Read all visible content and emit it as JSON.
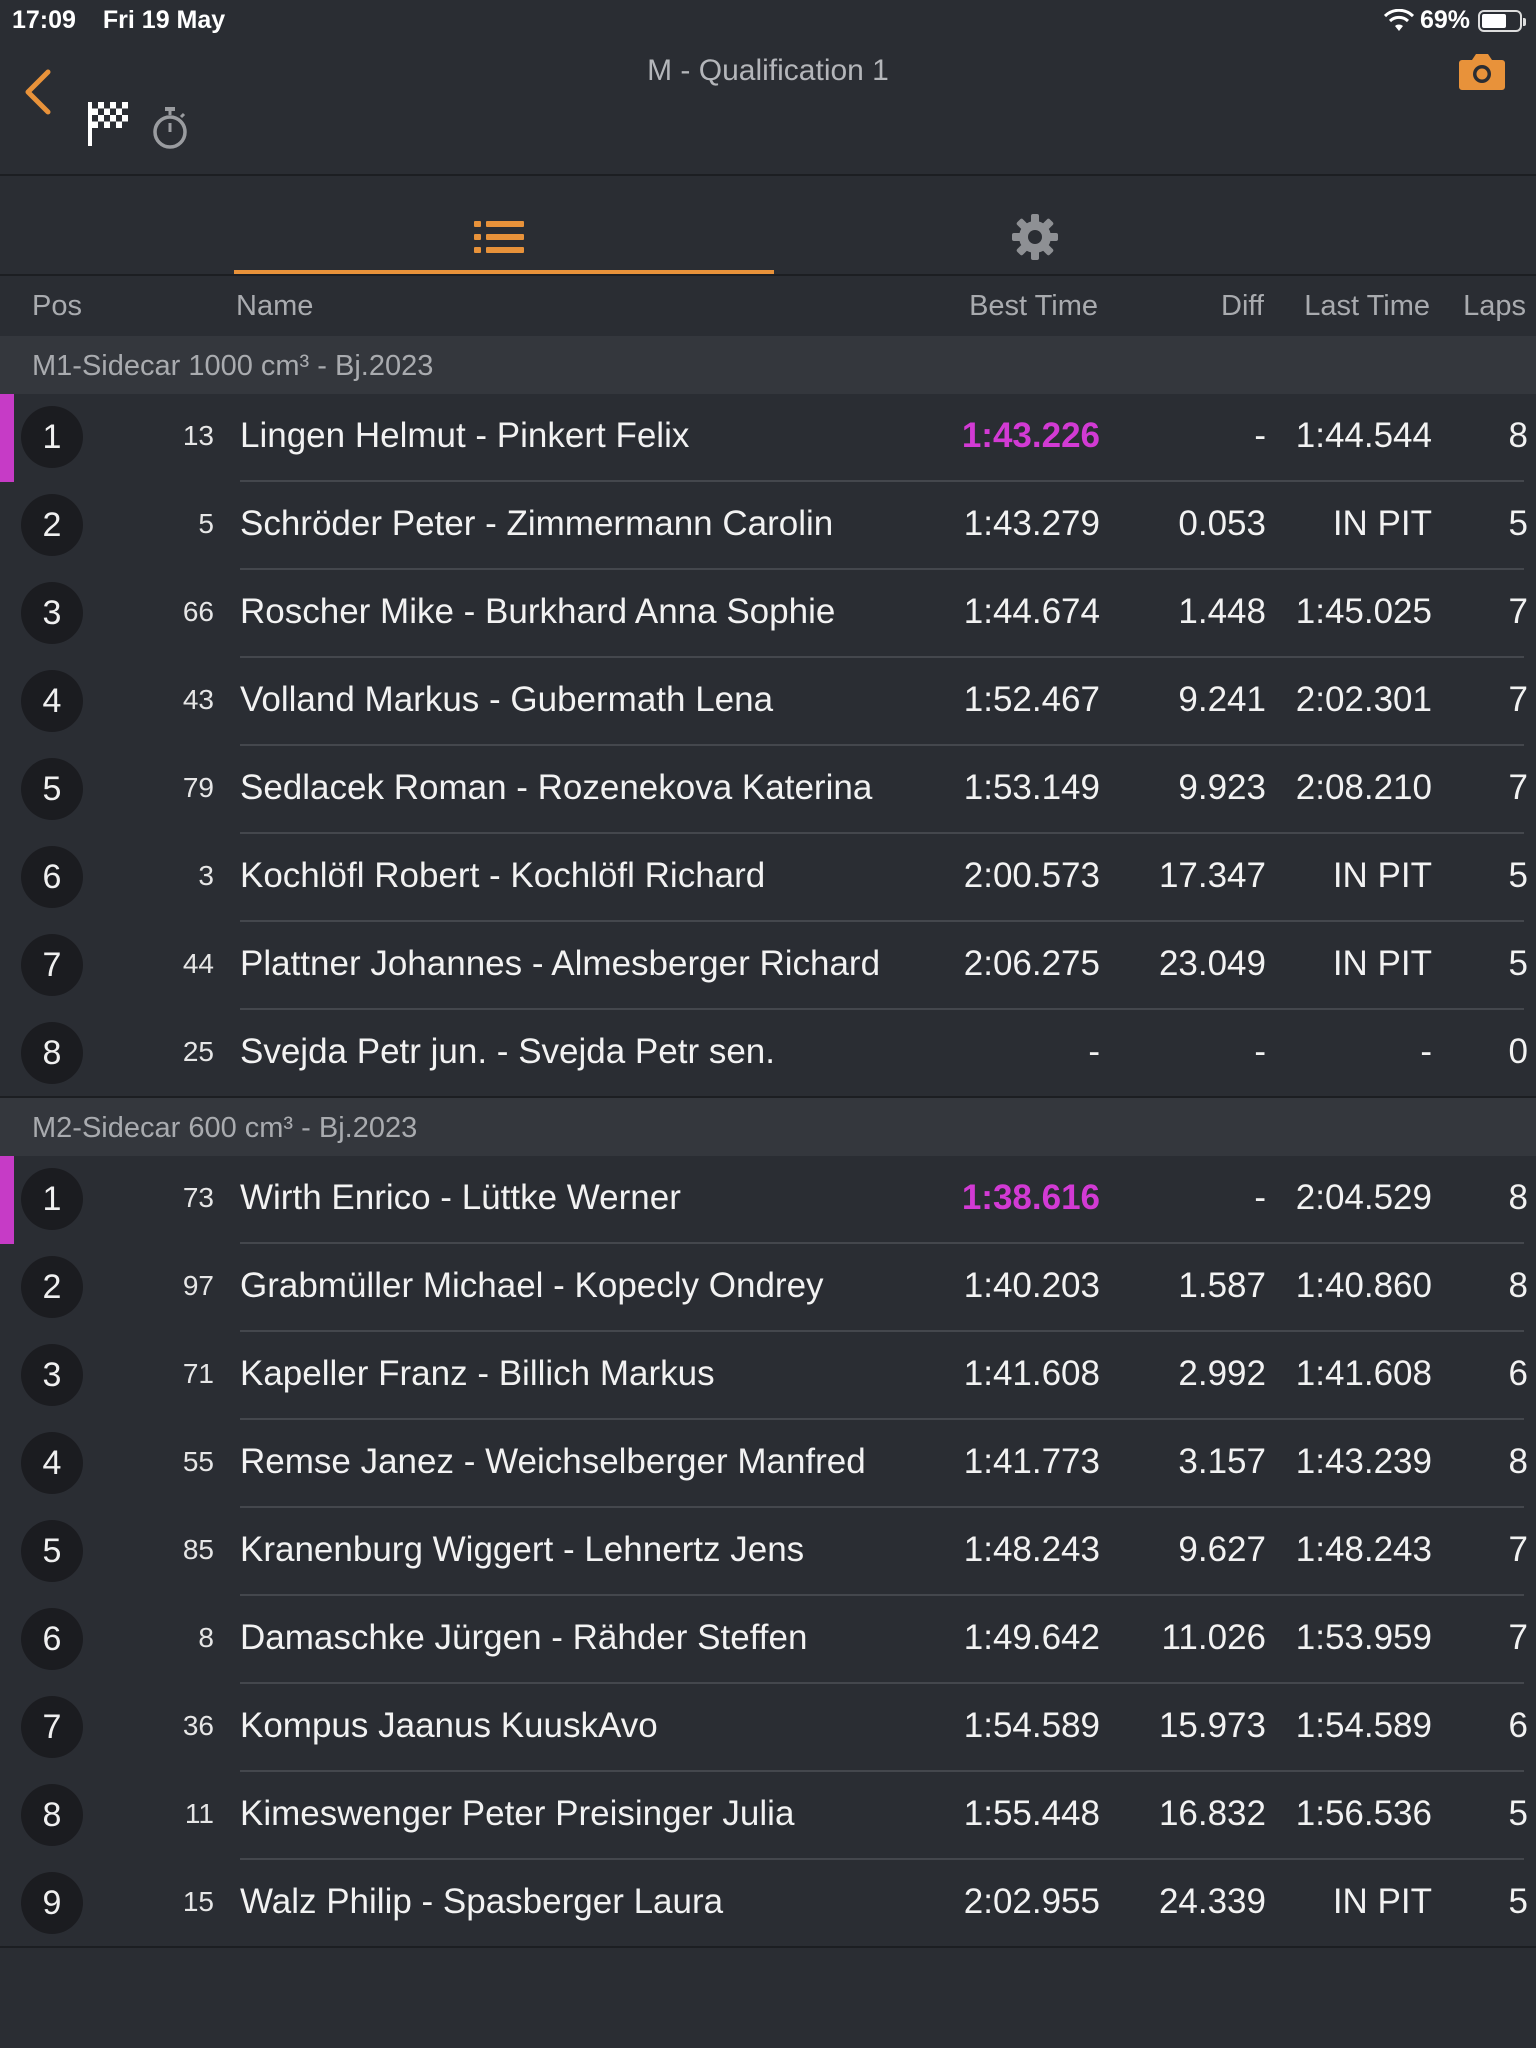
{
  "status": {
    "time": "17:09",
    "date": "Fri 19 May",
    "battery": "69%",
    "battery_level": 0.69
  },
  "header": {
    "title": "M - Qualification 1",
    "back_icon": "chevron-left-icon",
    "camera_icon": "camera-icon"
  },
  "colors": {
    "accent": "#e8923a",
    "fastest": "#d23ad4",
    "background": "#2a2d33"
  },
  "columns": {
    "pos": "Pos",
    "name": "Name",
    "best": "Best Time",
    "diff": "Diff",
    "last": "Last Time",
    "laps": "Laps"
  },
  "groups": [
    {
      "label": "M1-Sidecar 1000 cm³ - Bj.2023",
      "rows": [
        {
          "pos": "1",
          "num": "13",
          "name": "Lingen  Helmut - Pinkert Felix",
          "best": "1:43.226",
          "diff": "-",
          "last": "1:44.544",
          "laps": "8"
        },
        {
          "pos": "2",
          "num": "5",
          "name": "Schröder  Peter - Zimmermann Carolin",
          "best": "1:43.279",
          "diff": "0.053",
          "last": "IN PIT",
          "laps": "5"
        },
        {
          "pos": "3",
          "num": "66",
          "name": "Roscher Mike - Burkhard Anna Sophie",
          "best": "1:44.674",
          "diff": "1.448",
          "last": "1:45.025",
          "laps": "7"
        },
        {
          "pos": "4",
          "num": "43",
          "name": "Volland Markus - Gubermath Lena",
          "best": "1:52.467",
          "diff": "9.241",
          "last": "2:02.301",
          "laps": "7"
        },
        {
          "pos": "5",
          "num": "79",
          "name": "Sedlacek  Roman - Rozenekova  Katerina",
          "best": "1:53.149",
          "diff": "9.923",
          "last": "2:08.210",
          "laps": "7"
        },
        {
          "pos": "6",
          "num": "3",
          "name": "Kochlöfl  Robert - Kochlöfl Richard",
          "best": "2:00.573",
          "diff": "17.347",
          "last": "IN PIT",
          "laps": "5"
        },
        {
          "pos": "7",
          "num": "44",
          "name": "Plattner Johannes - Almesberger Richard",
          "best": "2:06.275",
          "diff": "23.049",
          "last": "IN PIT",
          "laps": "5"
        },
        {
          "pos": "8",
          "num": "25",
          "name": "Svejda  Petr jun. - Svejda Petr sen.",
          "best": "-",
          "diff": "-",
          "last": "-",
          "laps": "0"
        }
      ]
    },
    {
      "label": "M2-Sidecar 600 cm³ - Bj.2023",
      "rows": [
        {
          "pos": "1",
          "num": "73",
          "name": "Wirth  Enrico - Lüttke Werner",
          "best": "1:38.616",
          "diff": "-",
          "last": "2:04.529",
          "laps": "8"
        },
        {
          "pos": "2",
          "num": "97",
          "name": "Grabmüller  Michael - Kopecly Ondrey",
          "best": "1:40.203",
          "diff": "1.587",
          "last": "1:40.860",
          "laps": "8"
        },
        {
          "pos": "3",
          "num": "71",
          "name": "Kapeller  Franz - Billich Markus",
          "best": "1:41.608",
          "diff": "2.992",
          "last": "1:41.608",
          "laps": "6"
        },
        {
          "pos": "4",
          "num": "55",
          "name": "Remse  Janez - Weichselberger Manfred",
          "best": "1:41.773",
          "diff": "3.157",
          "last": "1:43.239",
          "laps": "8"
        },
        {
          "pos": "5",
          "num": "85",
          "name": "Kranenburg Wiggert - Lehnertz Jens",
          "best": "1:48.243",
          "diff": "9.627",
          "last": "1:48.243",
          "laps": "7"
        },
        {
          "pos": "6",
          "num": "8",
          "name": "Damaschke  Jürgen - Rähder Steffen",
          "best": "1:49.642",
          "diff": "11.026",
          "last": "1:53.959",
          "laps": "7"
        },
        {
          "pos": "7",
          "num": "36",
          "name": "Kompus Jaanus KuuskAvo",
          "best": "1:54.589",
          "diff": "15.973",
          "last": "1:54.589",
          "laps": "6"
        },
        {
          "pos": "8",
          "num": "11",
          "name": "Kimeswenger Peter Preisinger Julia",
          "best": "1:55.448",
          "diff": "16.832",
          "last": "1:56.536",
          "laps": "5"
        },
        {
          "pos": "9",
          "num": "15",
          "name": "Walz Philip - Spasberger Laura",
          "best": "2:02.955",
          "diff": "24.339",
          "last": "IN PIT",
          "laps": "5"
        }
      ]
    }
  ]
}
